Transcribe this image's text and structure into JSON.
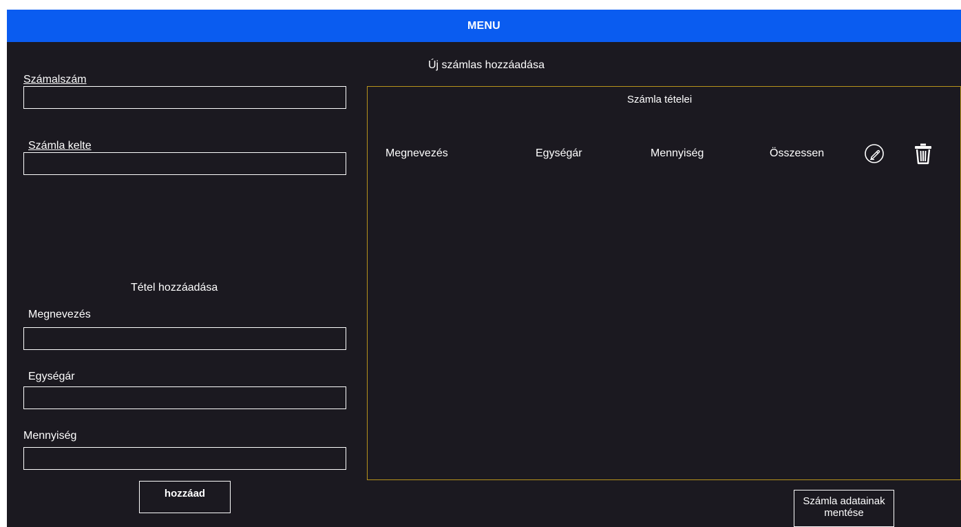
{
  "menu": {
    "label": "MENU",
    "color": "#0a5cf0"
  },
  "page_title": "Új számlas hozzáadása",
  "invoice_form": {
    "number_label": "Számalszám",
    "number_value": "",
    "date_label": "Számla kelte",
    "date_value": ""
  },
  "item_form": {
    "title": "Tétel hozzáadása",
    "name_label": "Megnevezés",
    "name_value": "",
    "unit_price_label": "Egységár",
    "unit_price_value": "",
    "quantity_label": "Mennyiség",
    "quantity_value": "",
    "add_button": "hozzáad"
  },
  "items_panel": {
    "title": "Számla tételei",
    "border_color": "#b8941c",
    "columns": [
      "Megnevezés",
      "Egységár",
      "Mennyiség",
      "Összessen"
    ],
    "edit_icon": "pencil-circle-icon",
    "delete_icon": "trash-icon",
    "rows": []
  },
  "save_button": "Számla adatainak mentése"
}
